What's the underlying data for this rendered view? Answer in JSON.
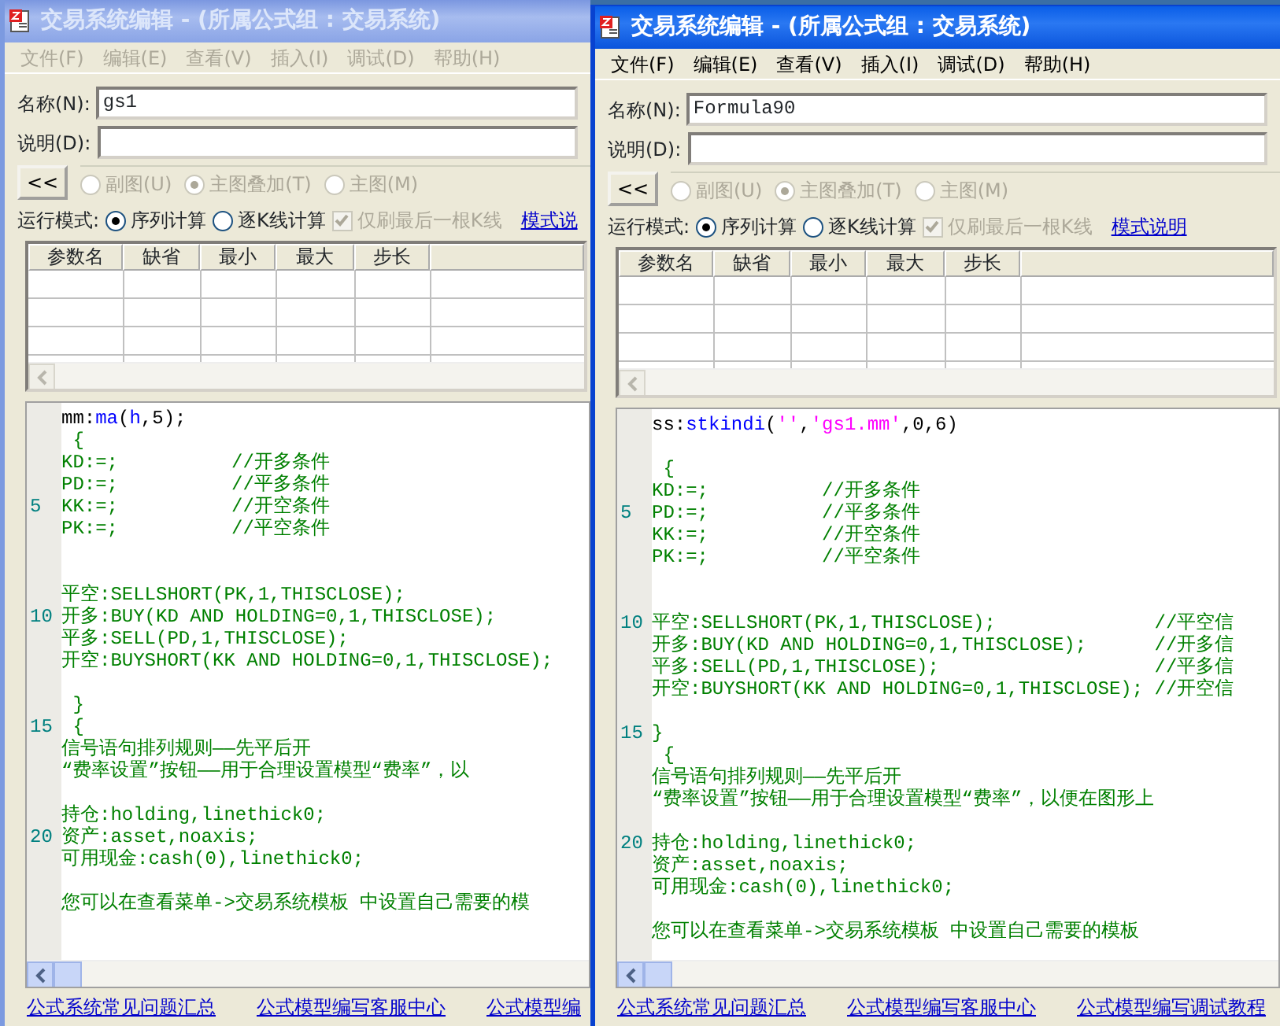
{
  "windows": [
    {
      "title": "交易系统编辑 - (所属公式组 : 交易系统)",
      "active": false,
      "menu": [
        "文件(F)",
        "编辑(E)",
        "查看(V)",
        "插入(I)",
        "调试(D)",
        "帮助(H)"
      ],
      "name_label": "名称(N):",
      "name_value": "gs1",
      "desc_label": "说明(D):",
      "collapse_button": "<<",
      "chart_options": [
        {
          "label": "副图(U)",
          "selected": false,
          "disabled": true
        },
        {
          "label": "主图叠加(T)",
          "selected": true,
          "disabled": true
        },
        {
          "label": "主图(M)",
          "selected": false,
          "disabled": true
        }
      ],
      "run_mode_label": "运行模式:",
      "run_modes": [
        {
          "label": "序列计算",
          "selected": true
        },
        {
          "label": "逐K线计算",
          "selected": false
        }
      ],
      "refresh_option": {
        "label": "仅刷最后一根K线",
        "checked": true,
        "disabled": true
      },
      "mode_link": "模式说",
      "param_columns": [
        "参数名",
        "缺省",
        "最小",
        "最大",
        "步长"
      ],
      "code_lines": [
        {
          "kind": "code",
          "segments": [
            {
              "kind": "plain",
              "text": "mm:"
            },
            {
              "kind": "func",
              "text": "ma"
            },
            {
              "kind": "plain",
              "text": "("
            },
            {
              "kind": "func",
              "text": "h"
            },
            {
              "kind": "plain",
              "text": ",5);"
            }
          ]
        },
        {
          "kind": "code",
          "segments": [
            {
              "kind": "code",
              "text": " {"
            }
          ]
        },
        {
          "kind": "code",
          "segments": [
            {
              "kind": "code",
              "text": "KD:=;          //开多条件"
            }
          ]
        },
        {
          "kind": "code",
          "segments": [
            {
              "kind": "code",
              "text": "PD:=;          //平多条件"
            }
          ]
        },
        {
          "kind": "code",
          "number": "5",
          "segments": [
            {
              "kind": "code",
              "text": "KK:=;          //开空条件"
            }
          ]
        },
        {
          "kind": "code",
          "segments": [
            {
              "kind": "code",
              "text": "PK:=;          //平空条件"
            }
          ]
        },
        {
          "kind": "blank"
        },
        {
          "kind": "blank"
        },
        {
          "kind": "code",
          "segments": [
            {
              "kind": "code",
              "text": "平空:SELLSHORT(PK,1,THISCLOSE);"
            }
          ]
        },
        {
          "kind": "code",
          "number": "10",
          "segments": [
            {
              "kind": "code",
              "text": "开多:BUY(KD AND HOLDING=0,1,THISCLOSE);"
            }
          ]
        },
        {
          "kind": "code",
          "segments": [
            {
              "kind": "code",
              "text": "平多:SELL(PD,1,THISCLOSE);"
            }
          ]
        },
        {
          "kind": "code",
          "segments": [
            {
              "kind": "code",
              "text": "开空:BUYSHORT(KK AND HOLDING=0,1,THISCLOSE);"
            }
          ]
        },
        {
          "kind": "blank"
        },
        {
          "kind": "code",
          "segments": [
            {
              "kind": "code",
              "text": " }"
            }
          ]
        },
        {
          "kind": "code",
          "number": "15",
          "segments": [
            {
              "kind": "code",
              "text": " {"
            }
          ]
        },
        {
          "kind": "code",
          "segments": [
            {
              "kind": "code",
              "text": "信号语句排列规则——先平后开"
            }
          ]
        },
        {
          "kind": "code",
          "segments": [
            {
              "kind": "code",
              "text": "“费率设置”按钮——用于合理设置模型“费率”，以"
            }
          ]
        },
        {
          "kind": "blank"
        },
        {
          "kind": "code",
          "segments": [
            {
              "kind": "code",
              "text": "持仓:holding,linethick0;"
            }
          ]
        },
        {
          "kind": "code",
          "number": "20",
          "segments": [
            {
              "kind": "code",
              "text": "资产:asset,noaxis;"
            }
          ]
        },
        {
          "kind": "code",
          "segments": [
            {
              "kind": "code",
              "text": "可用现金:cash(0),linethick0;"
            }
          ]
        },
        {
          "kind": "blank"
        },
        {
          "kind": "code",
          "segments": [
            {
              "kind": "code",
              "text": "您可以在查看菜单->交易系统模板 中设置自己需要的模"
            }
          ]
        }
      ],
      "footer_links": [
        "公式系统常见问题汇总",
        "公式模型编写客服中心",
        "公式模型编"
      ]
    },
    {
      "title": "交易系统编辑 - (所属公式组 : 交易系统)",
      "active": true,
      "menu": [
        "文件(F)",
        "编辑(E)",
        "查看(V)",
        "插入(I)",
        "调试(D)",
        "帮助(H)"
      ],
      "name_label": "名称(N):",
      "name_value": "Formula90",
      "desc_label": "说明(D):",
      "collapse_button": "<<",
      "chart_options": [
        {
          "label": "副图(U)",
          "selected": false,
          "disabled": true
        },
        {
          "label": "主图叠加(T)",
          "selected": true,
          "disabled": true
        },
        {
          "label": "主图(M)",
          "selected": false,
          "disabled": true
        }
      ],
      "run_mode_label": "运行模式:",
      "run_modes": [
        {
          "label": "序列计算",
          "selected": true
        },
        {
          "label": "逐K线计算",
          "selected": false
        }
      ],
      "refresh_option": {
        "label": "仅刷最后一根K线",
        "checked": true,
        "disabled": true
      },
      "mode_link": "模式说明",
      "param_columns": [
        "参数名",
        "缺省",
        "最小",
        "最大",
        "步长"
      ],
      "code_lines": [
        {
          "kind": "code",
          "segments": [
            {
              "kind": "plain",
              "text": "ss:"
            },
            {
              "kind": "func",
              "text": "stkindi"
            },
            {
              "kind": "plain",
              "text": "("
            },
            {
              "kind": "string",
              "text": "''"
            },
            {
              "kind": "plain",
              "text": ","
            },
            {
              "kind": "string",
              "text": "'gs1.mm'"
            },
            {
              "kind": "plain",
              "text": ",0,6)"
            }
          ]
        },
        {
          "kind": "blank"
        },
        {
          "kind": "code",
          "segments": [
            {
              "kind": "code",
              "text": " {"
            }
          ]
        },
        {
          "kind": "code",
          "segments": [
            {
              "kind": "code",
              "text": "KD:=;          //开多条件"
            }
          ]
        },
        {
          "kind": "code",
          "number": "5",
          "segments": [
            {
              "kind": "code",
              "text": "PD:=;          //平多条件"
            }
          ]
        },
        {
          "kind": "code",
          "segments": [
            {
              "kind": "code",
              "text": "KK:=;          //开空条件"
            }
          ]
        },
        {
          "kind": "code",
          "segments": [
            {
              "kind": "code",
              "text": "PK:=;          //平空条件"
            }
          ]
        },
        {
          "kind": "blank"
        },
        {
          "kind": "blank"
        },
        {
          "kind": "code",
          "number": "10",
          "segments": [
            {
              "kind": "code",
              "text": "平空:SELLSHORT(PK,1,THISCLOSE);              //平空信"
            }
          ]
        },
        {
          "kind": "code",
          "segments": [
            {
              "kind": "code",
              "text": "开多:BUY(KD AND HOLDING=0,1,THISCLOSE);      //开多信"
            }
          ]
        },
        {
          "kind": "code",
          "segments": [
            {
              "kind": "code",
              "text": "平多:SELL(PD,1,THISCLOSE);                   //平多信"
            }
          ]
        },
        {
          "kind": "code",
          "segments": [
            {
              "kind": "code",
              "text": "开空:BUYSHORT(KK AND HOLDING=0,1,THISCLOSE); //开空信"
            }
          ]
        },
        {
          "kind": "blank"
        },
        {
          "kind": "code",
          "number": "15",
          "segments": [
            {
              "kind": "code",
              "text": "}"
            }
          ]
        },
        {
          "kind": "code",
          "segments": [
            {
              "kind": "code",
              "text": " {"
            }
          ]
        },
        {
          "kind": "code",
          "segments": [
            {
              "kind": "code",
              "text": "信号语句排列规则——先平后开"
            }
          ]
        },
        {
          "kind": "code",
          "segments": [
            {
              "kind": "code",
              "text": "“费率设置”按钮——用于合理设置模型“费率”，以便在图形上"
            }
          ]
        },
        {
          "kind": "blank"
        },
        {
          "kind": "code",
          "number": "20",
          "segments": [
            {
              "kind": "code",
              "text": "持仓:holding,linethick0;"
            }
          ]
        },
        {
          "kind": "code",
          "segments": [
            {
              "kind": "code",
              "text": "资产:asset,noaxis;"
            }
          ]
        },
        {
          "kind": "code",
          "segments": [
            {
              "kind": "code",
              "text": "可用现金:cash(0),linethick0;"
            }
          ]
        },
        {
          "kind": "blank"
        },
        {
          "kind": "code",
          "segments": [
            {
              "kind": "code",
              "text": "您可以在查看菜单->交易系统模板 中设置自己需要的模板"
            }
          ]
        }
      ],
      "footer_links": [
        "公式系统常见问题汇总",
        "公式模型编写客服中心",
        "公式模型编写调试教程"
      ]
    }
  ]
}
